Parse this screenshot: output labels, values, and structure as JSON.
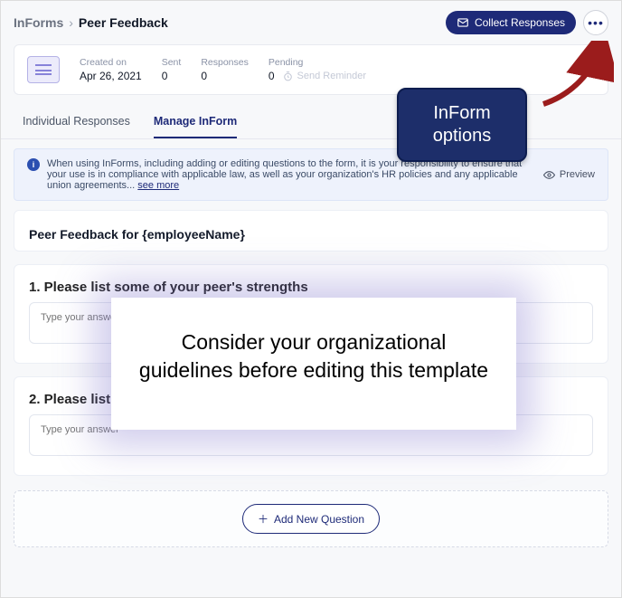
{
  "breadcrumb": {
    "app": "InForms",
    "page": "Peer Feedback"
  },
  "toolbar": {
    "collect_label": "Collect Responses"
  },
  "meta": {
    "created_label": "Created on",
    "created_value": "Apr 26, 2021",
    "sent_label": "Sent",
    "sent_value": "0",
    "responses_label": "Responses",
    "responses_value": "0",
    "pending_label": "Pending",
    "pending_value": "0",
    "send_reminder": "Send Reminder"
  },
  "tabs": {
    "individual": "Individual Responses",
    "manage": "Manage InForm"
  },
  "banner": {
    "text": "When using InForms, including adding or editing questions to the form, it is your responsibility to ensure that your use is in compliance with applicable law, as well as your organization's HR policies and any applicable union agreements... ",
    "see_more": "see more"
  },
  "preview_label": "Preview",
  "form": {
    "title": "Peer Feedback for {employeeName}",
    "questions": [
      {
        "title": "1. Please list some of your peer's strengths",
        "placeholder": "Type your answer"
      },
      {
        "title": "2. Please list some of your peer's improvement opportunities for your peer",
        "placeholder": "Type your answer"
      }
    ],
    "add_question": "Add New Question"
  },
  "callout": {
    "title": "InForm options"
  },
  "overlay": {
    "text": "Consider your organizational guidelines before editing this template"
  }
}
